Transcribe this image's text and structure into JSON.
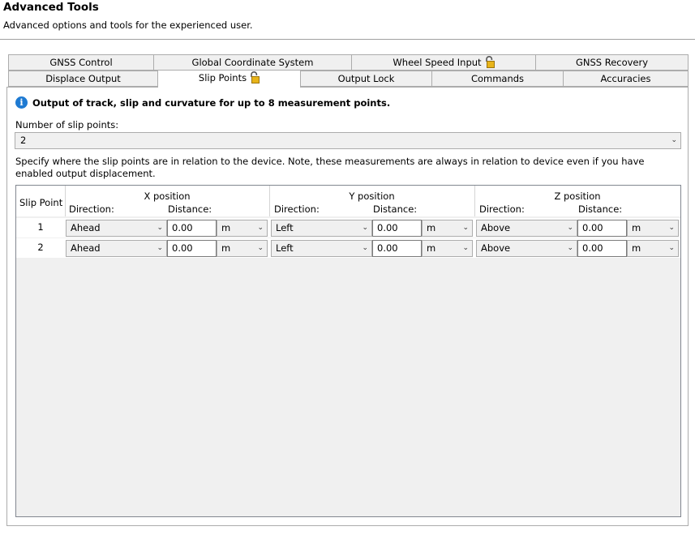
{
  "header": {
    "title": "Advanced Tools",
    "subtitle": "Advanced options and tools for the experienced user."
  },
  "tabs": {
    "row1": [
      "GNSS Control",
      "Global Coordinate System",
      "Wheel Speed Input",
      "GNSS Recovery"
    ],
    "row2": [
      "Displace Output",
      "Slip Points",
      "Output Lock",
      "Commands",
      "Accuracies"
    ],
    "selected": "Slip Points"
  },
  "icons": {
    "info": "info-icon",
    "lock": "padlock-icon",
    "dropdown": "chevron-down-icon"
  },
  "colors": {
    "info_blue": "#1e7ad2",
    "lock_gold": "#e8b419"
  },
  "content": {
    "info_text": "Output of track, slip and curvature for up to 8 measurement points.",
    "num_label": "Number of slip points:",
    "num_value": "2",
    "description": "Specify where the slip points are in relation to the device. Note, these measurements are always in relation to device even if you have enabled output displacement."
  },
  "grid": {
    "col_slip": "Slip Point",
    "groups": [
      "X position",
      "Y position",
      "Z position"
    ],
    "direction_label": "Direction:",
    "distance_label": "Distance:",
    "rows": [
      {
        "num": "1",
        "x_dir": "Ahead",
        "x_dist": "0.00",
        "x_unit": "m",
        "y_dir": "Left",
        "y_dist": "0.00",
        "y_unit": "m",
        "z_dir": "Above",
        "z_dist": "0.00",
        "z_unit": "m"
      },
      {
        "num": "2",
        "x_dir": "Ahead",
        "x_dist": "0.00",
        "x_unit": "m",
        "y_dir": "Left",
        "y_dist": "0.00",
        "y_unit": "m",
        "z_dir": "Above",
        "z_dist": "0.00",
        "z_unit": "m"
      }
    ]
  }
}
